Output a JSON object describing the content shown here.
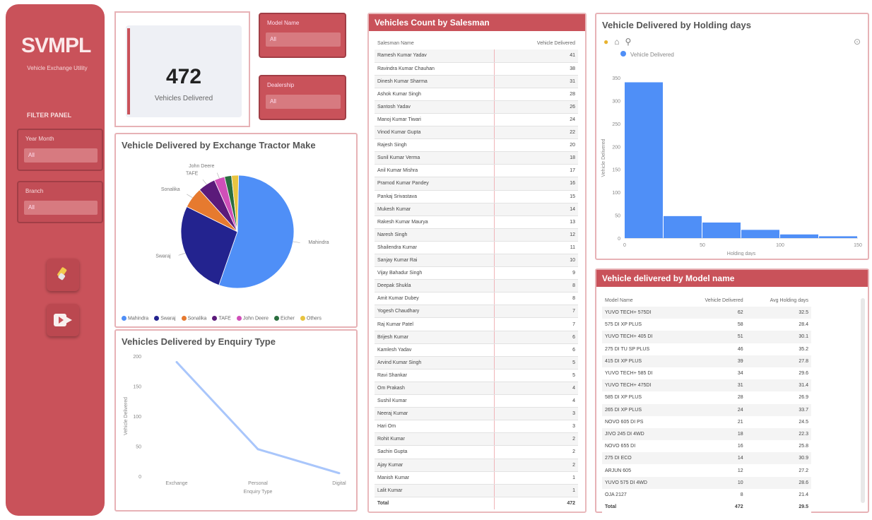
{
  "sidebar": {
    "brand": "SVMPL",
    "brand_sub": "Vehicle Exchange Utility",
    "filter_title": "FILTER PANEL",
    "filters": [
      {
        "label": "Year Month",
        "value": "All"
      },
      {
        "label": "Branch",
        "value": "All"
      }
    ],
    "buttons": [
      "eraser-icon",
      "play-icon"
    ]
  },
  "kpi": {
    "value": "472",
    "label": "Vehicles Delivered"
  },
  "top_filters": [
    {
      "label": "Model Name",
      "value": "All"
    },
    {
      "label": "Dealership",
      "value": "All"
    }
  ],
  "dealer_panel": {
    "title": "Vehicles Count by Salesman",
    "col_name": "Salesman Name",
    "col_count": "Vehicle Delivered",
    "rows": [
      [
        "Ramesh Kumar Yadav",
        "41"
      ],
      [
        "Ravindra Kumar Chauhan",
        "38"
      ],
      [
        "Dinesh Kumar Sharma",
        "31"
      ],
      [
        "Ashok Kumar Singh",
        "28"
      ],
      [
        "Santosh Yadav",
        "26"
      ],
      [
        "Manoj Kumar Tiwari",
        "24"
      ],
      [
        "Vinod Kumar Gupta",
        "22"
      ],
      [
        "Rajesh Singh",
        "20"
      ],
      [
        "Sunil Kumar Verma",
        "18"
      ],
      [
        "Anil Kumar Mishra",
        "17"
      ],
      [
        "Pramod Kumar Pandey",
        "16"
      ],
      [
        "Pankaj Srivastava",
        "15"
      ],
      [
        "Mukesh Kumar",
        "14"
      ],
      [
        "Rakesh Kumar Maurya",
        "13"
      ],
      [
        "Naresh Singh",
        "12"
      ],
      [
        "Shailendra Kumar",
        "11"
      ],
      [
        "Sanjay Kumar Rai",
        "10"
      ],
      [
        "Vijay Bahadur Singh",
        "9"
      ],
      [
        "Deepak Shukla",
        "8"
      ],
      [
        "Amit Kumar Dubey",
        "8"
      ],
      [
        "Yogesh Chaudhary",
        "7"
      ],
      [
        "Raj Kumar Patel",
        "7"
      ],
      [
        "Brijesh Kumar",
        "6"
      ],
      [
        "Kamlesh Yadav",
        "6"
      ],
      [
        "Arvind Kumar Singh",
        "5"
      ],
      [
        "Ravi Shankar",
        "5"
      ],
      [
        "Om Prakash",
        "4"
      ],
      [
        "Sushil Kumar",
        "4"
      ],
      [
        "Neeraj Kumar",
        "3"
      ],
      [
        "Hari Om",
        "3"
      ],
      [
        "Rohit Kumar",
        "2"
      ],
      [
        "Sachin Gupta",
        "2"
      ],
      [
        "Ajay Kumar",
        "2"
      ],
      [
        "Manish Kumar",
        "1"
      ],
      [
        "Lalit Kumar",
        "1"
      ]
    ],
    "total_label": "Total",
    "total_value": "472"
  },
  "holding_panel": {
    "title": "Vehicle Delivered by Holding days",
    "legend": "Vehicle Delivered",
    "toolbar": [
      "lightbulb-icon",
      "home-icon",
      "zoom-icon"
    ]
  },
  "pie_panel": {
    "title": "Vehicle Delivered by Exchange Tractor Make"
  },
  "line_panel": {
    "title": "Vehicles Delivered by Enquiry Type"
  },
  "model_panel": {
    "title": "Vehicle delivered by Model name",
    "col_name": "Model Name",
    "col_count": "Vehicle Delivered",
    "col_avg": "Avg Holding days",
    "rows": [
      [
        "YUVO TECH+ 575DI",
        "62",
        "32.5"
      ],
      [
        "575 DI XP PLUS",
        "58",
        "28.4"
      ],
      [
        "YUVO TECH+ 405 DI",
        "51",
        "30.1"
      ],
      [
        "275 DI TU SP PLUS",
        "46",
        "35.2"
      ],
      [
        "415 DI XP PLUS",
        "39",
        "27.8"
      ],
      [
        "YUVO TECH+ 585 DI",
        "34",
        "29.6"
      ],
      [
        "YUVO TECH+ 475DI",
        "31",
        "31.4"
      ],
      [
        "585 DI XP PLUS",
        "28",
        "26.9"
      ],
      [
        "265 DI XP PLUS",
        "24",
        "33.7"
      ],
      [
        "NOVO 605 DI PS",
        "21",
        "24.5"
      ],
      [
        "JIVO 245 DI 4WD",
        "18",
        "22.3"
      ],
      [
        "NOVO 655 DI",
        "16",
        "25.8"
      ],
      [
        "275 DI ECO",
        "14",
        "30.9"
      ],
      [
        "ARJUN 605",
        "12",
        "27.2"
      ],
      [
        "YUVO 575 DI 4WD",
        "10",
        "28.6"
      ],
      [
        "OJA 2127",
        "8",
        "21.4"
      ]
    ],
    "total_label": "Total",
    "total_value": "472",
    "total_avg": "29.5"
  },
  "chart_data": [
    {
      "type": "bar",
      "title": "Vehicle Delivered by Holding days",
      "series": [
        {
          "name": "Vehicle Delivered",
          "values": [
            340,
            48,
            34,
            18,
            8,
            4
          ]
        }
      ],
      "categories": [
        "0-25",
        "25-50",
        "50-75",
        "75-100",
        "100-125",
        "125-150"
      ],
      "xlabel": "Holding days",
      "ylabel": "Vehicle Delivered",
      "ylim": [
        0,
        350
      ],
      "y_ticks": [
        "0",
        "50",
        "100",
        "150",
        "200",
        "250",
        "300",
        "350"
      ],
      "x_ticks": [
        "0",
        "50",
        "100",
        "150"
      ]
    },
    {
      "type": "pie",
      "title": "Vehicle Delivered by Exchange Tractor Make",
      "categories": [
        "Mahindra",
        "Swaraj",
        "Sonalika",
        "TAFE",
        "John Deere",
        "Eicher",
        "Others"
      ],
      "values": [
        55,
        27,
        6,
        5,
        3,
        2,
        2
      ],
      "colors": [
        "#4f8ff7",
        "#23238f",
        "#e67a2f",
        "#5b1a7a",
        "#d04fb8",
        "#2a6e3f",
        "#e8c440"
      ],
      "slice_labels": [
        "Mahindra",
        "Swaraj",
        "Sonalika",
        "TAFE",
        "John Deere"
      ]
    },
    {
      "type": "line",
      "title": "Vehicles Delivered by Enquiry Type",
      "categories": [
        "Exchange",
        "Personal",
        "Digital"
      ],
      "values": [
        190,
        45,
        5
      ],
      "xlabel": "Enquiry Type",
      "ylabel": "Vehicle Delivered",
      "ylim": [
        0,
        200
      ],
      "y_ticks": [
        "0",
        "50",
        "100",
        "150",
        "200"
      ]
    }
  ]
}
